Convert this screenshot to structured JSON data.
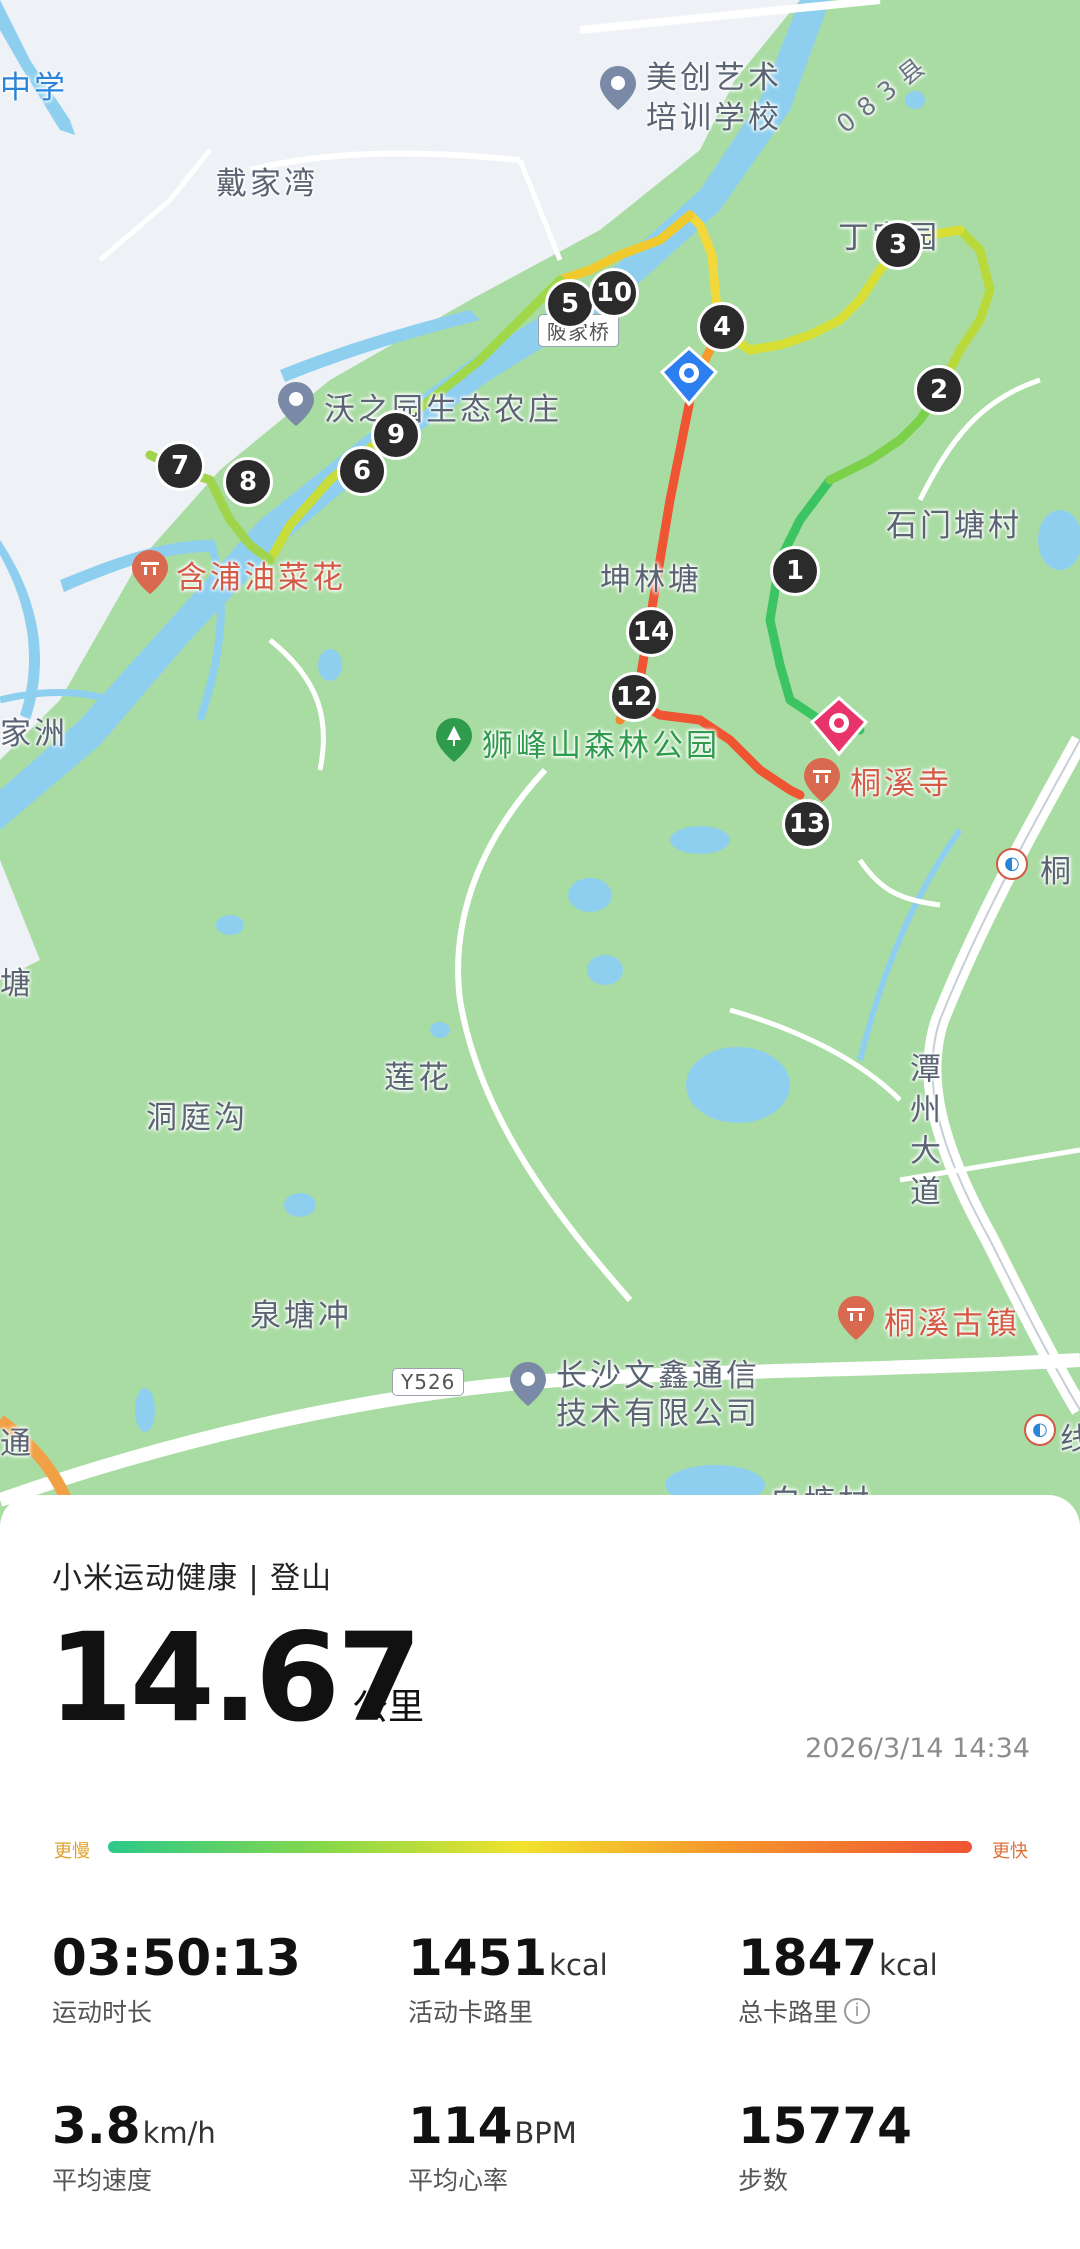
{
  "map": {
    "labels": {
      "zhongxue": "中学",
      "daijiawan": "戴家湾",
      "meichuang_1": "美创艺术",
      "meichuang_2": "培训学校",
      "road_083": "083县",
      "dingjia": "丁家园",
      "bridge": "陂家桥",
      "wozhiyuan": "沃之园生态农庄",
      "shimentang": "石门塘村",
      "hanpu": "含浦油菜花",
      "kunlintang": "坤林塘",
      "jiazhou": "家洲",
      "shifengshan": "狮峰山森林公园",
      "tongxisi": "桐溪寺",
      "tong_edge": "桐",
      "tang_edge": "塘",
      "lianhua": "莲花",
      "dongtinggou": "洞庭沟",
      "tanzhou": "潭州大道",
      "quantangchong": "泉塘冲",
      "tongxiguzhen": "桐溪古镇",
      "y526": "Y526",
      "wenxin_1": "长沙文鑫通信",
      "wenxin_2": "技术有限公司",
      "baitang": "白塘村",
      "edge_left": "通",
      "edge_right": "线"
    },
    "markers": [
      "1",
      "2",
      "3",
      "4",
      "5",
      "6",
      "7",
      "8",
      "9",
      "10",
      "12",
      "13",
      "14"
    ],
    "start_icon": "start-pin-icon",
    "end_icon": "end-pin-icon"
  },
  "card": {
    "app_title": "小米运动健康 | 登山",
    "distance": "14.67",
    "distance_unit": "公里",
    "datetime": "2026/3/14 14:34",
    "pace_slow": "更慢",
    "pace_fast": "更快",
    "stats": {
      "duration": {
        "value": "03:50:13",
        "unit": "",
        "label": "运动时长"
      },
      "active_cal": {
        "value": "1451",
        "unit": "kcal",
        "label": "活动卡路里"
      },
      "total_cal": {
        "value": "1847",
        "unit": "kcal",
        "label": "总卡路里"
      },
      "speed": {
        "value": "3.8",
        "unit": "km/h",
        "label": "平均速度"
      },
      "heart": {
        "value": "114",
        "unit": "BPM",
        "label": "平均心率"
      },
      "steps": {
        "value": "15774",
        "unit": "",
        "label": "步数"
      }
    }
  },
  "colors": {
    "map_green": "#a9dca3",
    "map_urban": "#eef1f5",
    "river": "#8ecff0",
    "route_slow": "#2cc98a",
    "route_mid": "#f2e22c",
    "route_fast": "#ef5533",
    "end_pin": "#e8336b",
    "start_pin": "#2d7ff0"
  }
}
